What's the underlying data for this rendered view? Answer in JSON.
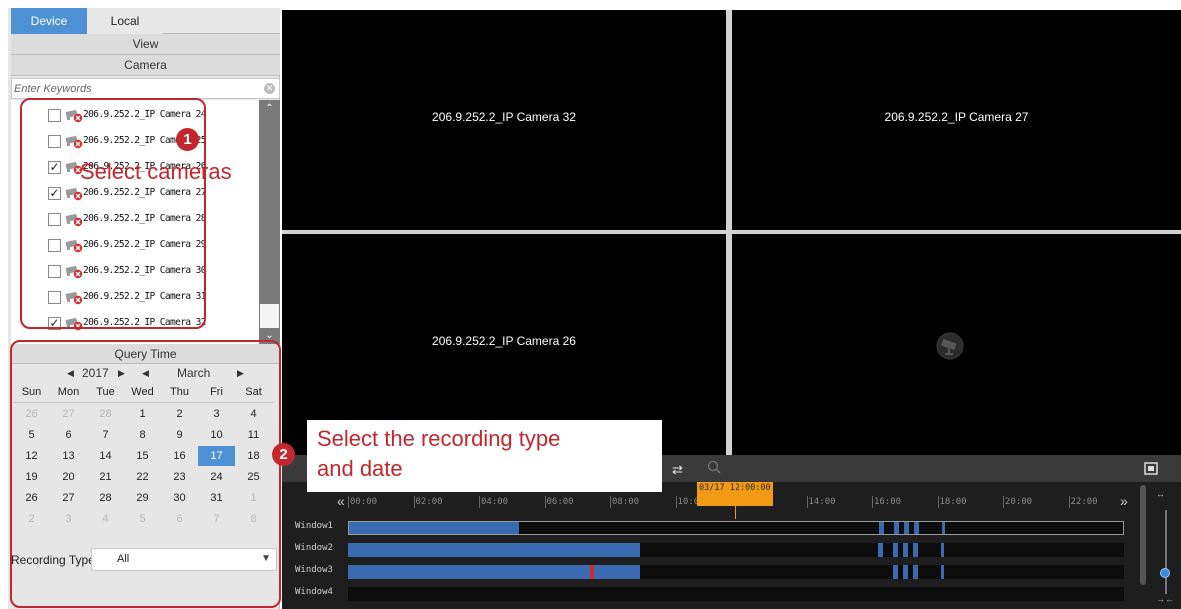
{
  "tabs": {
    "device": "Device",
    "local": "Local"
  },
  "view_label": "View",
  "camera_label": "Camera",
  "search": {
    "placeholder": "Enter Keywords"
  },
  "cameras": [
    {
      "label": "206.9.252.2_IP Camera 24",
      "checked": false
    },
    {
      "label": "206.9.252.2_IP Camera 25",
      "checked": false
    },
    {
      "label": "206.9.252.2_IP Camera 26",
      "checked": true
    },
    {
      "label": "206.9.252.2_IP Camera 27",
      "checked": true
    },
    {
      "label": "206.9.252.2_IP Camera 28",
      "checked": false
    },
    {
      "label": "206.9.252.2_IP Camera 29",
      "checked": false
    },
    {
      "label": "206.9.252.2_IP Camera 30",
      "checked": false
    },
    {
      "label": "206.9.252.2_IP Camera 31",
      "checked": false
    },
    {
      "label": "206.9.252.2_IP Camera 32",
      "checked": true
    }
  ],
  "query_time_label": "Query Time",
  "calendar": {
    "year": "2017",
    "month": "March",
    "weekdays": [
      "Sun",
      "Mon",
      "Tue",
      "Wed",
      "Thu",
      "Fri",
      "Sat"
    ],
    "weeks": [
      [
        "26",
        "27",
        "28",
        "1",
        "2",
        "3",
        "4"
      ],
      [
        "5",
        "6",
        "7",
        "8",
        "9",
        "10",
        "11"
      ],
      [
        "12",
        "13",
        "14",
        "15",
        "16",
        "17",
        "18"
      ],
      [
        "19",
        "20",
        "21",
        "22",
        "23",
        "24",
        "25"
      ],
      [
        "26",
        "27",
        "28",
        "29",
        "30",
        "31",
        "1"
      ],
      [
        "2",
        "3",
        "4",
        "5",
        "6",
        "7",
        "8"
      ]
    ],
    "selected_day": "17"
  },
  "recording_type": {
    "label": "Recording Type",
    "value": "All"
  },
  "annotations": {
    "badge_1": "1",
    "badge_2": "2",
    "callout_1": "Select cameras",
    "callout_2_line1": "Select the recording type",
    "callout_2_line2": "and date",
    "color": "#c1272d"
  },
  "video_windows": [
    {
      "label": "206.9.252.2_IP Camera 32"
    },
    {
      "label": "206.9.252.2_IP Camera 27"
    },
    {
      "label": "206.9.252.2_IP Camera 26"
    },
    {
      "label": ""
    }
  ],
  "timeline": {
    "ticks": [
      "00:00",
      "02:00",
      "04:00",
      "06:00",
      "08:00",
      "10:00",
      "12:00",
      "14:00",
      "16:00",
      "18:00",
      "20:00",
      "22:00"
    ],
    "marker_date": "03/17",
    "marker_time": "12:00:00",
    "rows": [
      {
        "label": "Window1"
      },
      {
        "label": "Window2"
      },
      {
        "label": "Window3"
      },
      {
        "label": "Window4"
      }
    ]
  },
  "colors": {
    "accent": "#4d90d4",
    "record": "#3a6ab0",
    "marker": "#f29a13"
  }
}
